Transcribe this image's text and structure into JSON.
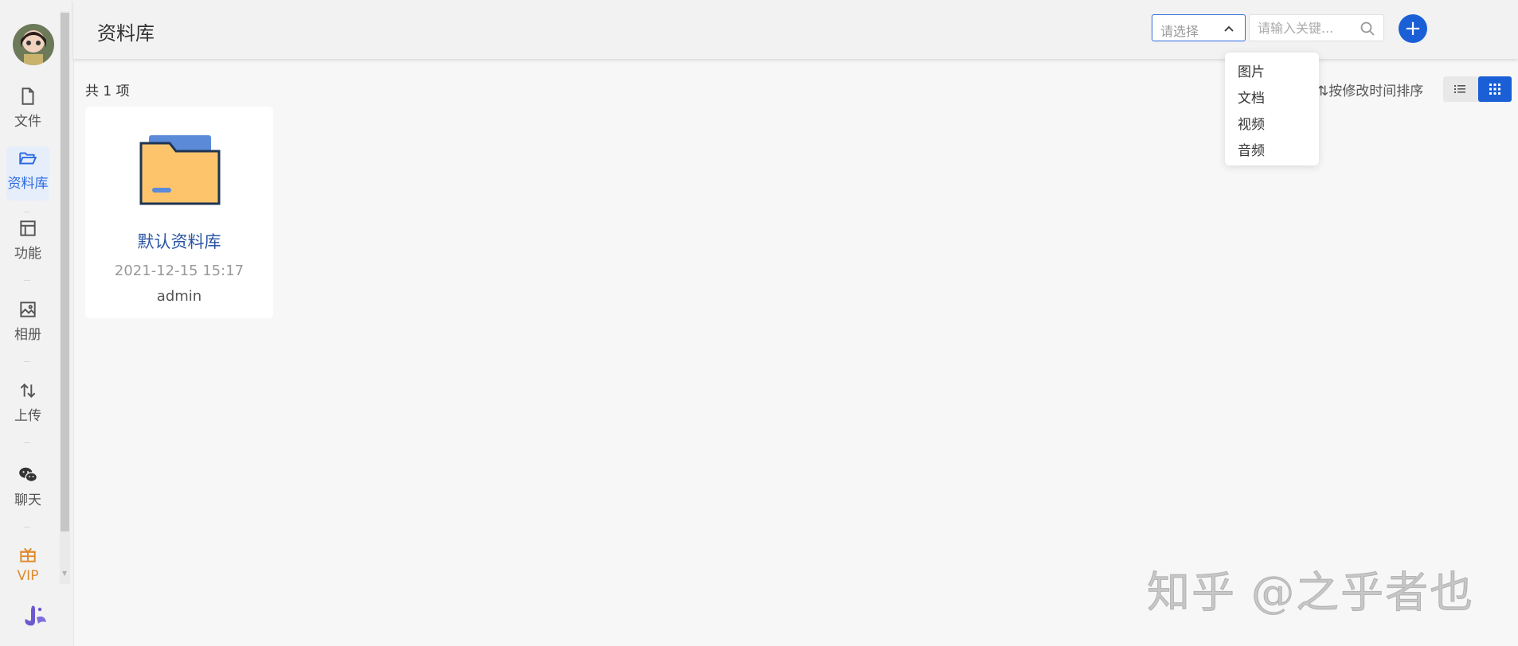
{
  "sidebar": {
    "items": [
      {
        "label": "文件",
        "icon": "file-icon"
      },
      {
        "label": "资料库",
        "icon": "folder-open-icon"
      },
      {
        "label": "功能",
        "icon": "layout-icon"
      },
      {
        "label": "相册",
        "icon": "image-icon"
      },
      {
        "label": "上传",
        "icon": "transfer-icon"
      },
      {
        "label": "聊天",
        "icon": "wechat-icon"
      },
      {
        "label": "VIP",
        "icon": "gift-icon"
      }
    ],
    "active_index": 1
  },
  "header": {
    "title": "资料库",
    "type_select_placeholder": "请选择",
    "search_placeholder": "请输入关键...",
    "add_label": "+"
  },
  "type_dropdown": {
    "options": [
      "图片",
      "文档",
      "视频",
      "音频"
    ]
  },
  "toolbar": {
    "count_text": "共 1 项",
    "sort_label": "⇅按修改时间排序"
  },
  "libraries": [
    {
      "name": "默认资料库",
      "modified": "2021-12-15 15:17",
      "owner": "admin"
    }
  ],
  "watermark": "知乎 @之乎者也",
  "colors": {
    "accent": "#1a5fd6",
    "active_nav": "#2d6be0",
    "vip": "#e08a2c",
    "folder_body": "#fec46c",
    "folder_back": "#5b8ad8"
  }
}
